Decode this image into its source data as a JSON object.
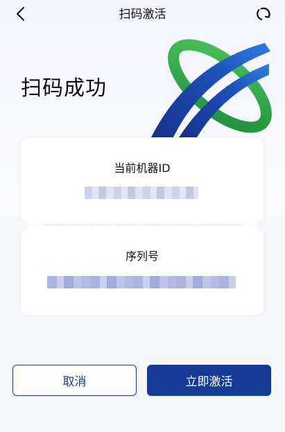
{
  "header": {
    "back_icon": "chevron-left-icon",
    "title": "扫码激活",
    "refresh_icon": "refresh-icon"
  },
  "hero": {
    "title": "扫码成功",
    "logo_icon": "company-logo",
    "colors": {
      "green": "#2ea84a",
      "blue": "#1c3f9a"
    }
  },
  "cards": {
    "machine_id": {
      "label": "当前机器ID"
    },
    "serial": {
      "label": "序列号"
    }
  },
  "actions": {
    "cancel_label": "取消",
    "activate_label": "立即激活"
  },
  "colors": {
    "primary": "#163b97",
    "background": "#f6f7fb",
    "card": "#ffffff"
  }
}
